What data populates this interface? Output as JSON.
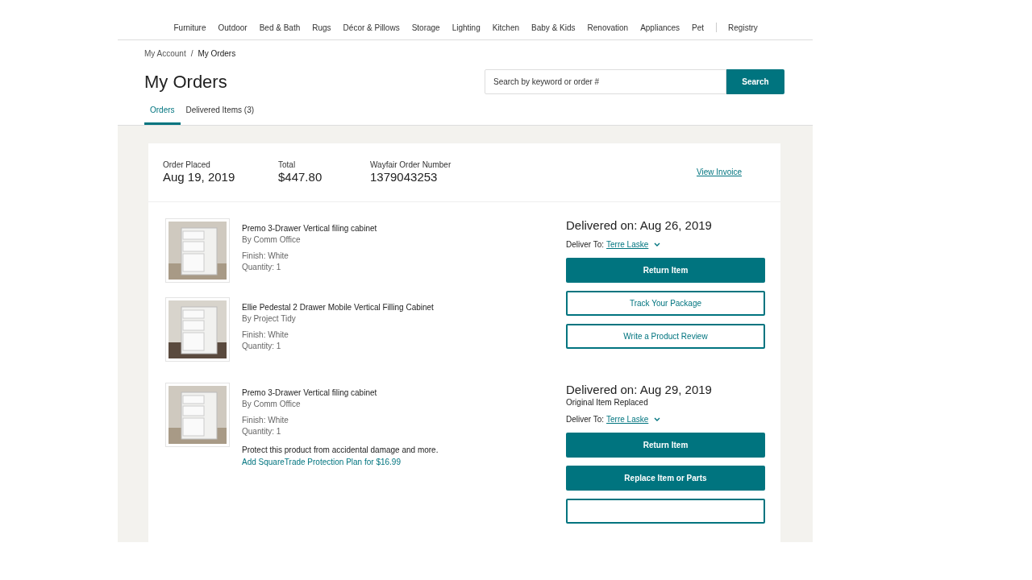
{
  "nav": [
    {
      "label": "Furniture",
      "divider_before": false
    },
    {
      "label": "Outdoor",
      "divider_before": false
    },
    {
      "label": "Bed & Bath",
      "divider_before": false
    },
    {
      "label": "Rugs",
      "divider_before": false
    },
    {
      "label": "Décor & Pillows",
      "divider_before": false
    },
    {
      "label": "Storage",
      "divider_before": false
    },
    {
      "label": "Lighting",
      "divider_before": false
    },
    {
      "label": "Kitchen",
      "divider_before": false
    },
    {
      "label": "Baby & Kids",
      "divider_before": false
    },
    {
      "label": "Renovation",
      "divider_before": false
    },
    {
      "label": "Appliances",
      "divider_before": false
    },
    {
      "label": "Pet",
      "divider_before": false
    },
    {
      "label": "Registry",
      "divider_before": true
    }
  ],
  "breadcrumb": {
    "items": [
      "My Account",
      "My Orders"
    ],
    "separator": "/"
  },
  "title": "My Orders",
  "search": {
    "placeholder": "Search by keyword or order #",
    "button": "Search"
  },
  "tabs": [
    {
      "label": "Orders",
      "selected": true
    },
    {
      "label": "Delivered Items (3)",
      "selected": false
    }
  ],
  "order": {
    "summary": [
      {
        "label": "Order Placed",
        "value": "Aug 19, 2019"
      },
      {
        "label": "Total",
        "value": "$447.80"
      },
      {
        "label": "Wayfair Order Number",
        "value": "1379043253"
      }
    ],
    "invoice_link": "View Invoice",
    "deliveries": [
      {
        "items": [
          {
            "name": "Premo 3-Drawer Vertical filing cabinet",
            "brand": "By Comm Office",
            "finish": "Finish: White",
            "quantity": "Quantity: 1"
          },
          {
            "name": "Ellie Pedestal 2 Drawer Mobile Vertical Filling Cabinet",
            "brand": "By Project Tidy",
            "finish": "Finish: White",
            "quantity": "Quantity: 1"
          }
        ],
        "status": "Delivered on: Aug 26, 2019",
        "deliver_to_label": "Deliver To:",
        "recipient": "Terre Laske",
        "buttons": [
          {
            "kind": "filled",
            "label": "Return Item"
          },
          {
            "kind": "outlined",
            "label": "Track Your Package"
          },
          {
            "kind": "outlined",
            "label": "Write a Product Review"
          }
        ]
      },
      {
        "items": [
          {
            "name": "Premo 3-Drawer Vertical filing cabinet",
            "brand": "By Comm Office",
            "finish": "Finish: White",
            "quantity": "Quantity: 1",
            "protection_text": "Protect this product from accidental damage and more.",
            "protection_link": "Add SquareTrade Protection Plan for $16.99"
          }
        ],
        "status": "Delivered on: Aug 29, 2019",
        "note": "Original Item Replaced",
        "deliver_to_label": "Deliver To:",
        "recipient": "Terre Laske",
        "buttons": [
          {
            "kind": "filled",
            "label": "Return Item"
          },
          {
            "kind": "filled",
            "label": "Replace Item or Parts"
          },
          {
            "kind": "outlined"
          }
        ]
      }
    ]
  }
}
